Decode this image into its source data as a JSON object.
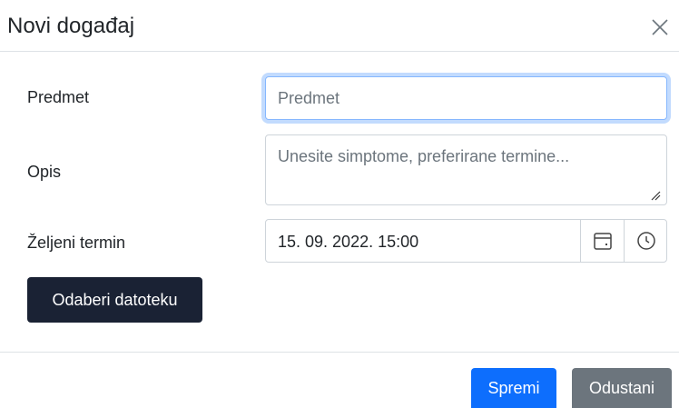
{
  "modal": {
    "title": "Novi događaj",
    "close_icon": "close-icon"
  },
  "form": {
    "subject": {
      "label": "Predmet",
      "placeholder": "Predmet",
      "value": "",
      "focused": true
    },
    "description": {
      "label": "Opis",
      "placeholder": "Unesite simptome, preferirane termine...",
      "value": ""
    },
    "preferred_time": {
      "label": "Željeni termin",
      "value": "15. 09. 2022. 15:00",
      "calendar_icon": "calendar-icon",
      "clock_icon": "clock-icon"
    },
    "file_button_label": "Odaberi datoteku"
  },
  "footer": {
    "save_label": "Spremi",
    "cancel_label": "Odustani"
  },
  "colors": {
    "primary": "#0d6efd",
    "secondary": "#6c757d",
    "dark_button": "#1a2234",
    "focus_border": "#86b7fe"
  }
}
